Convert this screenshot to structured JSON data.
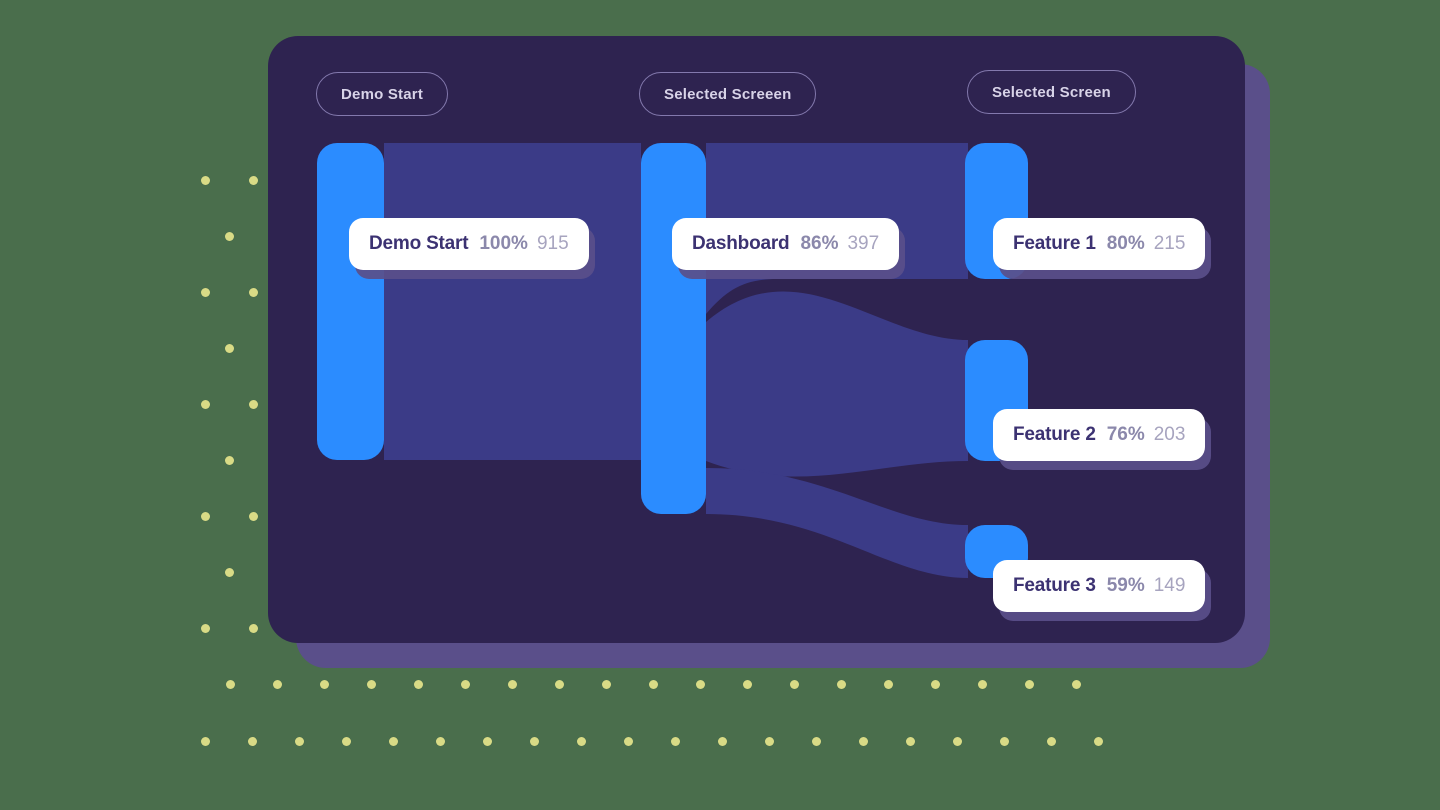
{
  "canvas": {
    "background_color": "#4a6e4c",
    "card_color": "#2e2350",
    "card_shadow_color": "#5a4f8a",
    "bar_color": "#2b8cff",
    "link_color": "#3b3b87",
    "dot_color": "#d9db86"
  },
  "legend": {
    "pills": [
      {
        "label": "Demo Start"
      },
      {
        "label": "Selected Screeen"
      },
      {
        "label": "Selected Screen"
      }
    ]
  },
  "chart_data": {
    "type": "sankey",
    "title": "",
    "xlabel": "",
    "ylabel": "",
    "total": 915,
    "columns": [
      {
        "index": 0,
        "title": "Demo Start"
      },
      {
        "index": 1,
        "title": "Selected Screeen"
      },
      {
        "index": 2,
        "title": "Selected Screen"
      }
    ],
    "nodes": [
      {
        "id": "demo-start",
        "label": "Demo Start",
        "percent": "100%",
        "count": "915",
        "value": 915,
        "column": 0
      },
      {
        "id": "dashboard",
        "label": "Dashboard",
        "percent": "86%",
        "count": "397",
        "value": 397,
        "column": 1
      },
      {
        "id": "feature-1",
        "label": "Feature 1",
        "percent": "80%",
        "count": "215",
        "value": 215,
        "column": 2
      },
      {
        "id": "feature-2",
        "label": "Feature 2",
        "percent": "76%",
        "count": "203",
        "value": 203,
        "column": 2
      },
      {
        "id": "feature-3",
        "label": "Feature 3",
        "percent": "59%",
        "count": "149",
        "value": 149,
        "column": 2
      }
    ],
    "links": [
      {
        "source": "demo-start",
        "target": "dashboard",
        "value": 397
      },
      {
        "source": "dashboard",
        "target": "feature-1",
        "value": 215
      },
      {
        "source": "dashboard",
        "target": "feature-2",
        "value": 203
      },
      {
        "source": "dashboard",
        "target": "feature-3",
        "value": 149
      }
    ]
  }
}
